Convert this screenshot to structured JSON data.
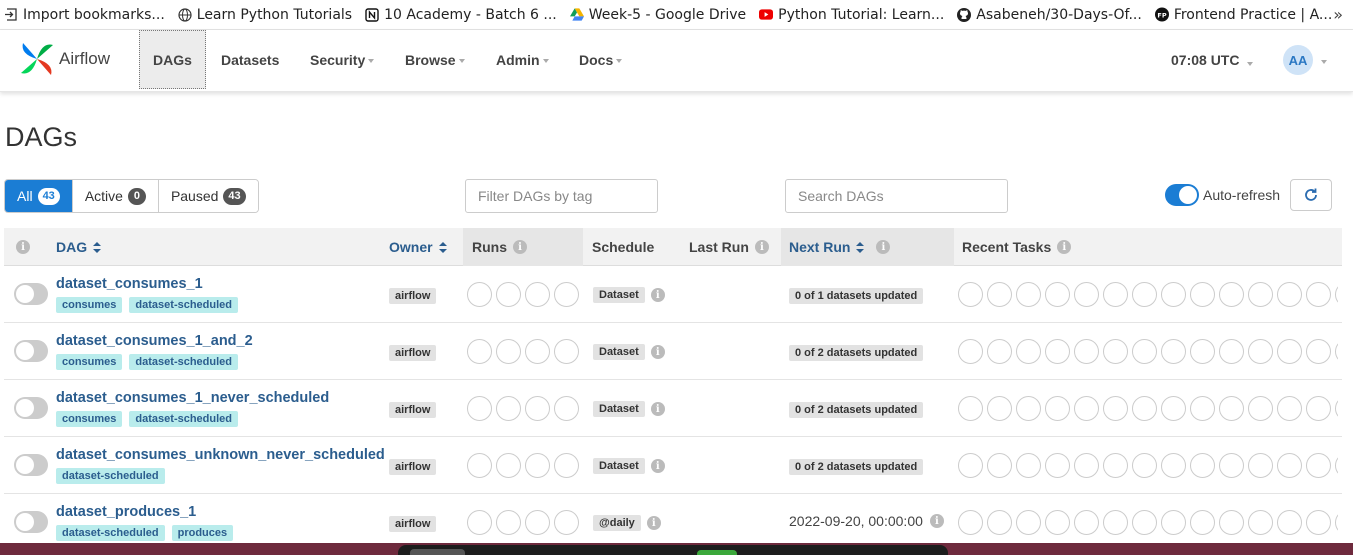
{
  "bookmarks": [
    {
      "label": "Import bookmarks...",
      "icon": "import-icon"
    },
    {
      "label": "Learn Python Tutorials",
      "icon": "globe-icon"
    },
    {
      "label": "10 Academy - Batch 6 ...",
      "icon": "notion-icon"
    },
    {
      "label": "Week-5 - Google Drive",
      "icon": "google-drive-icon"
    },
    {
      "label": "Python Tutorial: Learn...",
      "icon": "youtube-icon"
    },
    {
      "label": "Asabeneh/30-Days-Of...",
      "icon": "github-icon"
    },
    {
      "label": "Frontend Practice | A...",
      "icon": "fp-icon"
    }
  ],
  "bookmarks_more": "»",
  "navbar": {
    "brand": "Airflow",
    "items": [
      "DAGs",
      "Datasets",
      "Security",
      "Browse",
      "Admin",
      "Docs"
    ],
    "clock": "07:08 UTC",
    "avatar": "AA"
  },
  "page_title": "DAGs",
  "filters": {
    "all": {
      "label": "All",
      "count": "43"
    },
    "active": {
      "label": "Active",
      "count": "0"
    },
    "paused": {
      "label": "Paused",
      "count": "43"
    }
  },
  "tag_filter_placeholder": "Filter DAGs by tag",
  "search_placeholder": "Search DAGs",
  "auto_refresh_label": "Auto-refresh",
  "table": {
    "columns": {
      "dag": "DAG",
      "owner": "Owner",
      "runs": "Runs",
      "schedule": "Schedule",
      "last_run": "Last Run",
      "next_run": "Next Run",
      "recent_tasks": "Recent Tasks"
    },
    "rows": [
      {
        "name": "dataset_consumes_1",
        "tags": [
          "consumes",
          "dataset-scheduled"
        ],
        "owner": "airflow",
        "schedule": "Dataset",
        "next_run": "0 of 1 datasets updated",
        "next_is_badge": true
      },
      {
        "name": "dataset_consumes_1_and_2",
        "tags": [
          "consumes",
          "dataset-scheduled"
        ],
        "owner": "airflow",
        "schedule": "Dataset",
        "next_run": "0 of 2 datasets updated",
        "next_is_badge": true
      },
      {
        "name": "dataset_consumes_1_never_scheduled",
        "tags": [
          "consumes",
          "dataset-scheduled"
        ],
        "owner": "airflow",
        "schedule": "Dataset",
        "next_run": "0 of 2 datasets updated",
        "next_is_badge": true
      },
      {
        "name": "dataset_consumes_unknown_never_scheduled",
        "tags": [
          "dataset-scheduled"
        ],
        "owner": "airflow",
        "schedule": "Dataset",
        "next_run": "0 of 2 datasets updated",
        "next_is_badge": true
      },
      {
        "name": "dataset_produces_1",
        "tags": [
          "dataset-scheduled",
          "produces"
        ],
        "owner": "airflow",
        "schedule": "@daily",
        "next_run": "2022-09-20, 00:00:00",
        "next_is_badge": false
      }
    ]
  },
  "colors": {
    "accent": "#1b7dd4",
    "link": "#2b5d8e",
    "tag_bg": "#b9ecec"
  }
}
